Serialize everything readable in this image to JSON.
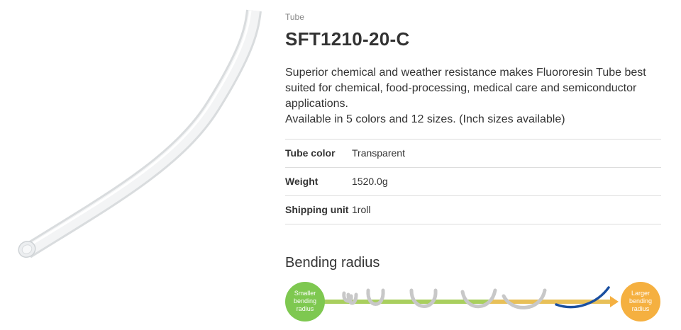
{
  "product": {
    "category": "Tube",
    "title": "SFT1210-20-C",
    "description_lines": [
      "Superior chemical and weather resistance makes Fluororesin Tube best",
      "suited for chemical, food-processing, medical care and semiconductor",
      "applications.",
      "Available in 5 colors and 12 sizes. (Inch sizes available)"
    ]
  },
  "specs": [
    {
      "label": "Tube color",
      "value": "Transparent"
    },
    {
      "label": "Weight",
      "value": "1520.0g"
    },
    {
      "label": "Shipping unit",
      "value": "1roll"
    }
  ],
  "bending": {
    "title": "Bending radius",
    "smaller_label": [
      "Smaller",
      "bending",
      "radius"
    ],
    "larger_label": [
      "Larger",
      "bending",
      "radius"
    ],
    "colors": {
      "green": "#7ec850",
      "orange": "#f5b040",
      "tube_gray": "#c8c8c8",
      "tube_blue": "#1a4fa0"
    }
  },
  "image": {
    "subject": "tube-image",
    "tube_color": "#e6e8ea"
  }
}
